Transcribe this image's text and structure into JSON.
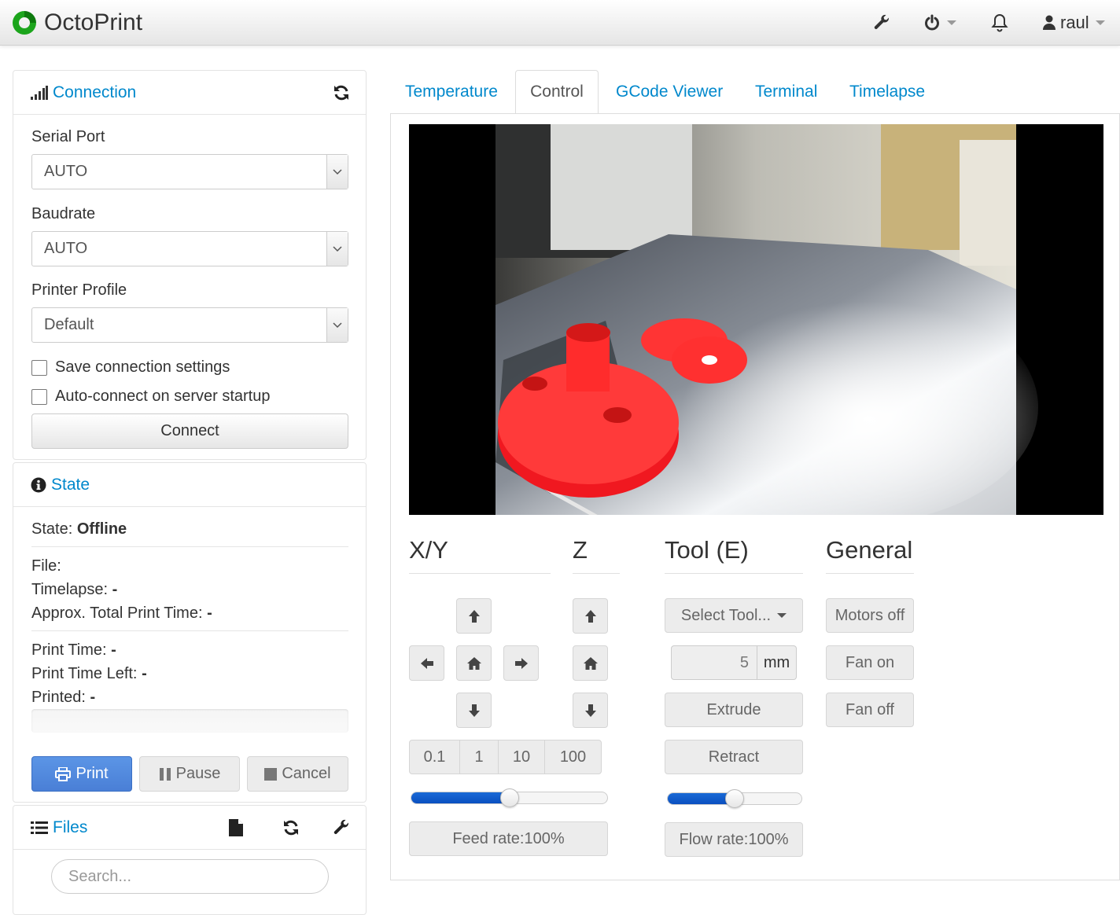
{
  "navbar": {
    "brand": "OctoPrint",
    "icons": [
      "wrench-icon",
      "power-icon",
      "bell-icon",
      "user-icon"
    ],
    "username": "raul"
  },
  "sidebar": {
    "connection": {
      "title": "Connection",
      "serial_port_label": "Serial Port",
      "serial_port_value": "AUTO",
      "baudrate_label": "Baudrate",
      "baudrate_value": "AUTO",
      "printer_profile_label": "Printer Profile",
      "printer_profile_value": "Default",
      "save_settings_label": "Save connection settings",
      "autoconnect_label": "Auto-connect on server startup",
      "connect_button": "Connect"
    },
    "state": {
      "title": "State",
      "state_label": "State:",
      "state_value": "Offline",
      "file_label": "File:",
      "timelapse_label": "Timelapse:",
      "timelapse_value": "-",
      "total_time_label": "Approx. Total Print Time:",
      "total_time_value": "-",
      "print_time_label": "Print Time:",
      "print_time_value": "-",
      "time_left_label": "Print Time Left:",
      "time_left_value": "-",
      "printed_label": "Printed:",
      "printed_value": "-",
      "progress": 0,
      "print_button": "Print",
      "pause_button": "Pause",
      "cancel_button": "Cancel"
    },
    "files": {
      "title": "Files",
      "search_placeholder": "Search..."
    }
  },
  "tabs": [
    {
      "label": "Temperature",
      "active": false
    },
    {
      "label": "Control",
      "active": true
    },
    {
      "label": "GCode Viewer",
      "active": false
    },
    {
      "label": "Terminal",
      "active": false
    },
    {
      "label": "Timelapse",
      "active": false
    }
  ],
  "control": {
    "xy_title": "X/Y",
    "z_title": "Z",
    "tool_title": "Tool (E)",
    "general_title": "General",
    "steps": [
      "0.1",
      "1",
      "10",
      "100"
    ],
    "feed_rate_label": "Feed rate:100%",
    "feed_rate": 0.5,
    "select_tool_label": "Select Tool...",
    "extrude_amount": "5",
    "extrude_unit": "mm",
    "extrude_button": "Extrude",
    "retract_button": "Retract",
    "flow_rate_label": "Flow rate:100%",
    "flow_rate": 0.5,
    "motors_off_button": "Motors off",
    "fan_on_button": "Fan on",
    "fan_off_button": "Fan off"
  },
  "colors": {
    "link": "#0088cc",
    "primary_button": "#4a7fd6",
    "slider": "#0a4fc0",
    "logo_green": "#1ca51c"
  }
}
